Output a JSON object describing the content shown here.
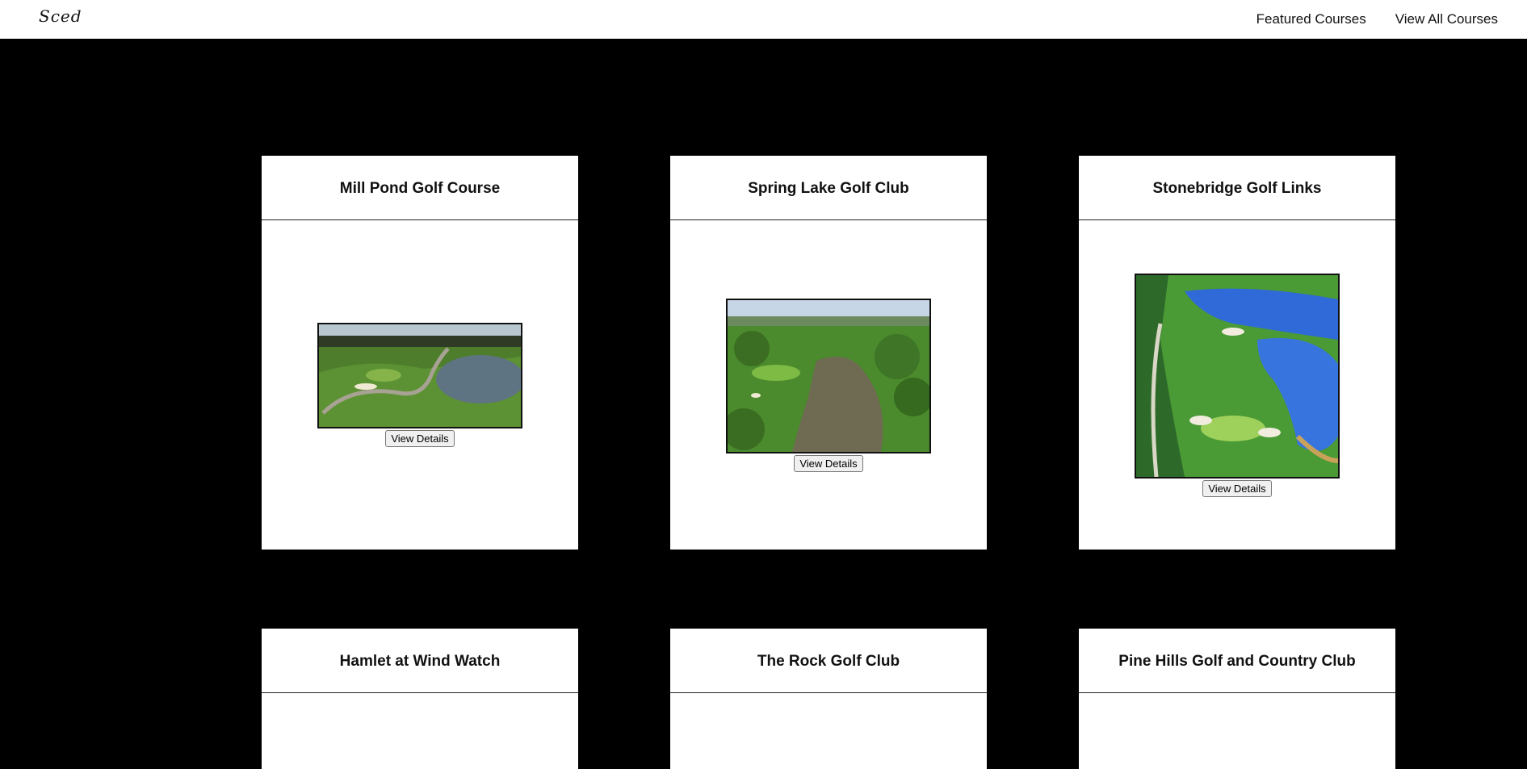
{
  "header": {
    "logo_text": "Sced",
    "nav": {
      "featured": "Featured Courses",
      "all": "View All Courses"
    }
  },
  "courses": [
    {
      "name": "Mill Pond Golf Course",
      "button": "View Details"
    },
    {
      "name": "Spring Lake Golf Club",
      "button": "View Details"
    },
    {
      "name": "Stonebridge Golf Links",
      "button": "View Details"
    },
    {
      "name": "Hamlet at Wind Watch"
    },
    {
      "name": "The Rock Golf Club"
    },
    {
      "name": "Pine Hills Golf and Country Club"
    }
  ],
  "colors": {
    "background": "#000000",
    "card": "#ffffff",
    "grass": "#4f8a2f",
    "water": "#3d6fb5"
  }
}
